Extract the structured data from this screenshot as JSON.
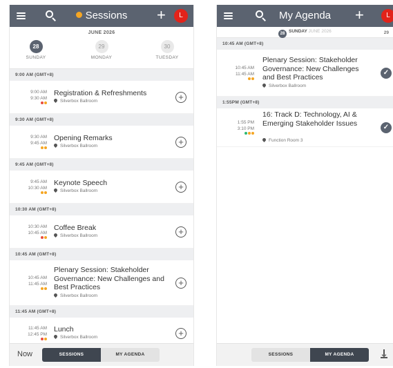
{
  "sessions_screen": {
    "title": "Sessions",
    "avatar": "L",
    "plus": "+",
    "month": "JUNE 2026",
    "days": [
      {
        "num": "28",
        "name": "SUNDAY"
      },
      {
        "num": "29",
        "name": "MONDAY"
      },
      {
        "num": "30",
        "name": "TUESDAY"
      }
    ],
    "sections": [
      {
        "header": "9:00 AM (GMT+8)",
        "start": "9:00 AM",
        "end": "9:30 AM",
        "title": "Registration & Refreshments",
        "location": "Silverbox Ballroom",
        "dots": [
          "#e94b3c",
          "#f5a623"
        ]
      },
      {
        "header": "9:30 AM (GMT+8)",
        "start": "9:30 AM",
        "end": "9:45 AM",
        "title": "Opening Remarks",
        "location": "Silverbox Ballroom",
        "dots": [
          "#f5a623",
          "#f5a623"
        ]
      },
      {
        "header": "9:45 AM (GMT+8)",
        "start": "9:45 AM",
        "end": "10:30 AM",
        "title": "Keynote Speech",
        "location": "Silverbox Ballroom",
        "dots": [
          "#f5a623",
          "#f5a623"
        ]
      },
      {
        "header": "10:30 AM (GMT+8)",
        "start": "10:30 AM",
        "end": "10:45 AM",
        "title": "Coffee Break",
        "location": "Silverbox Ballroom",
        "dots": [
          "#e94b3c",
          "#f5a623"
        ]
      },
      {
        "header": "10:45 AM (GMT+8)",
        "start": "10:45 AM",
        "end": "11:45 AM",
        "title": "Plenary Session: Stakeholder Governance: New Challenges and Best Practices",
        "location": "Silverbox Ballroom",
        "dots": [
          "#f5a623",
          "#f5a623"
        ]
      },
      {
        "header": "11:45 AM (GMT+8)",
        "start": "11:45 AM",
        "end": "12:45 PM",
        "title": "Lunch",
        "location": "Silverbox Ballroom",
        "dots": [
          "#e94b3c",
          "#f5a623"
        ]
      }
    ],
    "bottom": {
      "now": "Now",
      "tab_sessions": "SESSIONS",
      "tab_agenda": "MY AGENDA"
    }
  },
  "agenda_screen": {
    "title": "My Agenda",
    "avatar": "L",
    "plus": "+",
    "date_num": "28",
    "date_day": "SUNDAY",
    "date_month": "JUNE 2026",
    "next_day": "29",
    "sections": [
      {
        "header": "10:45 AM (GMT+8)",
        "start": "10:45 AM",
        "end": "11:45 AM",
        "title": "Plenary Session: Stakeholder Governance: New Challenges and Best Practices",
        "location": "Silverbox Ballroom",
        "dots": [
          "#f5a623",
          "#f5a623"
        ]
      },
      {
        "header": "1:55PM (GMT+8)",
        "start": "1:55 PM",
        "end": "3:10 PM",
        "title": "16: Track D: Technology, AI & Emerging Stakeholder Issues",
        "location": "Function Room 3",
        "dots": [
          "#2eb872",
          "#f5a623",
          "#f5a623"
        ]
      }
    ],
    "bottom": {
      "tab_sessions": "SESSIONS",
      "tab_agenda": "MY AGENDA"
    }
  }
}
